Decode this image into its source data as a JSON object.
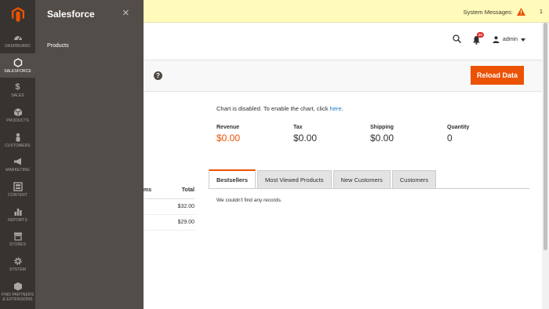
{
  "nav": {
    "items": [
      {
        "label": "DASHBOARD",
        "icon": "dashboard-icon"
      },
      {
        "label": "SALESFORCE",
        "icon": "hexagon-icon"
      },
      {
        "label": "SALES",
        "icon": "dollar-icon"
      },
      {
        "label": "PRODUCTS",
        "icon": "box-icon"
      },
      {
        "label": "CUSTOMERS",
        "icon": "person-icon"
      },
      {
        "label": "MARKETING",
        "icon": "megaphone-icon"
      },
      {
        "label": "CONTENT",
        "icon": "content-icon"
      },
      {
        "label": "REPORTS",
        "icon": "bar-chart-icon"
      },
      {
        "label": "STORES",
        "icon": "store-icon"
      },
      {
        "label": "SYSTEM",
        "icon": "gear-icon"
      },
      {
        "label": "FIND PARTNERS & EXTENSIONS",
        "icon": "extensions-icon"
      }
    ]
  },
  "panel": {
    "title": "Salesforce",
    "close": "×",
    "link": "Products"
  },
  "notice": {
    "label": "System Messages:",
    "count": "1"
  },
  "header": {
    "notifications_count": "20",
    "user": "admin"
  },
  "actions": {
    "help": "?",
    "reload": "Reload Data"
  },
  "dashboard": {
    "chart_msg": "Chart is disabled. To enable the chart, click",
    "chart_link": "here",
    "chart_msg_end": ".",
    "totals": [
      {
        "label": "Revenue",
        "value": "$0.00"
      },
      {
        "label": "Tax",
        "value": "$0.00"
      },
      {
        "label": "Shipping",
        "value": "$0.00"
      },
      {
        "label": "Quantity",
        "value": "0"
      }
    ],
    "left_table": {
      "col_items": "ms",
      "col_total": "Total",
      "rows": [
        "$32.00",
        "$29.00"
      ]
    },
    "tabs": [
      "Bestsellers",
      "Most Viewed Products",
      "New Customers",
      "Customers"
    ],
    "empty_msg": "We couldn't find any records."
  },
  "colors": {
    "accent": "#eb5202",
    "nav_bg": "#373330",
    "panel_bg": "#524d49",
    "notice_bg": "#fffbbb"
  }
}
